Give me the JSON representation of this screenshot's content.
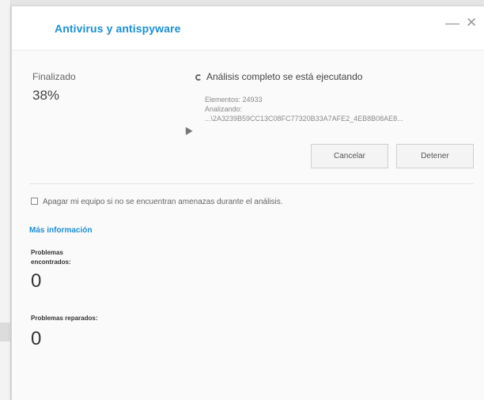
{
  "window": {
    "title": "Antivirus y antispyware",
    "minimize_glyph": "—",
    "close_glyph": "✕"
  },
  "status": {
    "label": "Finalizado",
    "percent": "38%"
  },
  "scan": {
    "title": "Análisis completo se está ejecutando",
    "items": "Elementos: 24933",
    "analyzing_label": "Analizando:",
    "current_path": "...\\2A3239B59CC13C08FC77320B33A7AFE2_4EB8B08AE8..."
  },
  "buttons": {
    "cancel": "Cancelar",
    "stop": "Detener"
  },
  "shutdown_option": {
    "label": "Apagar mi equipo si no se encuentran amenazas durante el análisis.",
    "checked": false
  },
  "more_info": "Más información",
  "results": {
    "found_label": "Problemas encontrados:",
    "found_count": "0",
    "fixed_label": "Problemas reparados:",
    "fixed_count": "0"
  },
  "colors": {
    "accent": "#1b8fd6"
  }
}
